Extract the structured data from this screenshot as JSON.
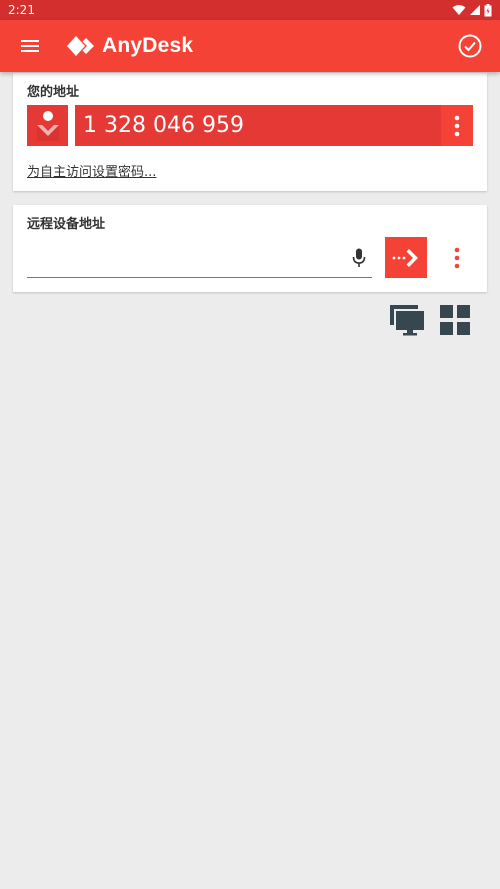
{
  "status_bar": {
    "time": "2:21",
    "icons": [
      "wifi-icon",
      "cell-signal-icon",
      "battery-icon"
    ]
  },
  "app_bar": {
    "title": "AnyDesk",
    "menu_icon": "hamburger-menu-icon",
    "action_icon": "check-circle-icon"
  },
  "your_address": {
    "label": "您的地址",
    "id": "1 328 046 959",
    "set_password_link": "为自主访问设置密码..."
  },
  "remote": {
    "label": "远程设备地址",
    "input_value": "",
    "input_placeholder": ""
  },
  "colors": {
    "accent": "#f44336",
    "accent_dark": "#e53935",
    "status_bar": "#d32f2f",
    "background": "#ececec",
    "icon_dark": "#37474f"
  }
}
